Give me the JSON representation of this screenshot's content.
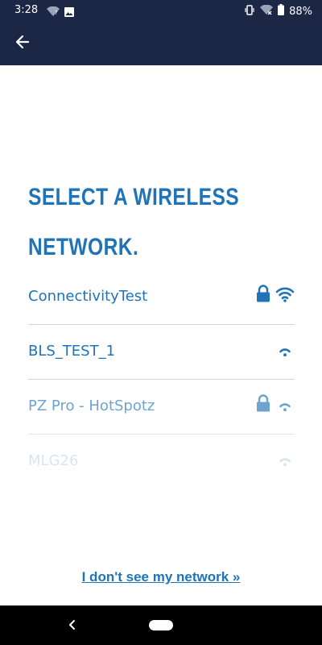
{
  "status_bar": {
    "time": "3:28",
    "battery": "88%",
    "left_icons": [
      "wifi-question-icon",
      "image-icon"
    ],
    "right_icons": [
      "vibrate-icon",
      "wifi-off-icon",
      "battery-icon"
    ]
  },
  "app_bar": {
    "back_icon": "back-arrow-icon",
    "color": "#1c2745"
  },
  "page": {
    "title_line1": "SELECT A WIRELESS",
    "title_line2": "NETWORK.",
    "accent_color": "#1f73b7"
  },
  "networks": [
    {
      "name": "ConnectivityTest",
      "secured": true,
      "signal": "full",
      "opacity": 1.0
    },
    {
      "name": "BLS_TEST_1",
      "secured": false,
      "signal": "low",
      "opacity": 1.0
    },
    {
      "name": "PZ Pro - HotSpotz",
      "secured": true,
      "signal": "low",
      "opacity": 0.65
    },
    {
      "name": "MLG26",
      "secured": false,
      "signal": "low",
      "opacity": 0.18
    }
  ],
  "footer": {
    "no_network_link": "I don't see my network »"
  },
  "nav_bar": {
    "back_icon": "nav-back-icon",
    "home_icon": "nav-home-pill"
  }
}
